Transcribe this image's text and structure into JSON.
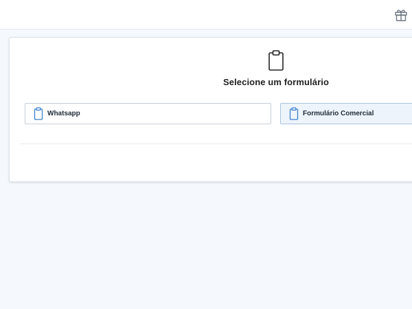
{
  "header": {
    "gift_icon": "gift-icon"
  },
  "form_picker": {
    "header_icon": "clipboard-icon",
    "title": "Selecione um formulário",
    "options": [
      {
        "label": "Whatsapp",
        "icon": "clipboard-icon",
        "selected": false
      },
      {
        "label": "Formulário Comercial",
        "icon": "clipboard-icon",
        "selected": true
      }
    ]
  },
  "colors": {
    "accent": "#3a7fd0",
    "selected_bg": "#eef4fb",
    "page_bg": "#f5f8fc"
  }
}
